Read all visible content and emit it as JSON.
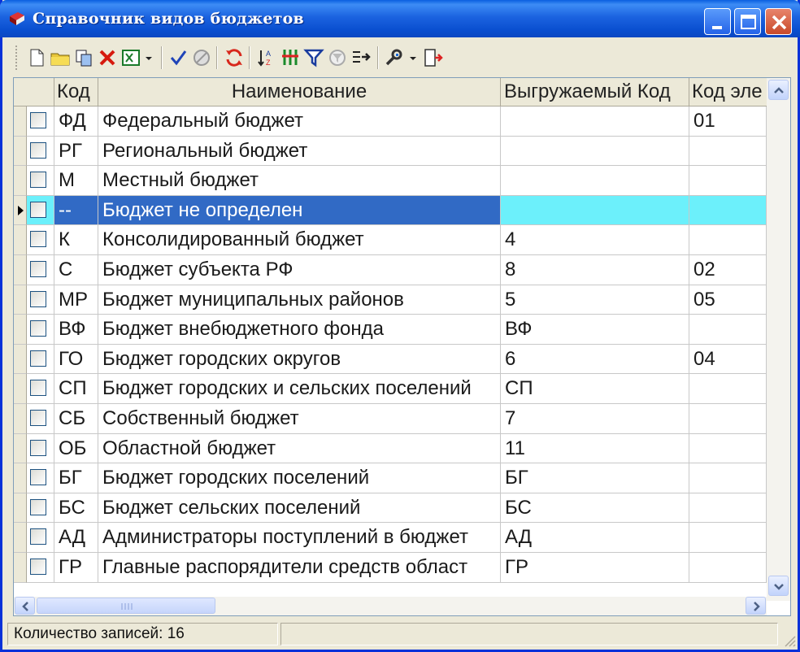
{
  "window": {
    "title": "Справочник видов бюджетов"
  },
  "toolbar": {
    "buttons": [
      {
        "icon": "new-document-icon"
      },
      {
        "icon": "open-folder-icon"
      },
      {
        "icon": "copy-icon"
      },
      {
        "icon": "delete-icon"
      },
      {
        "icon": "excel-export-icon"
      },
      {
        "icon": "dropdown-arrow-icon"
      },
      {
        "icon": "check-icon"
      },
      {
        "icon": "cancel-icon"
      },
      {
        "icon": "refresh-icon"
      },
      {
        "icon": "sort-icon"
      },
      {
        "icon": "column-icon"
      },
      {
        "icon": "filter-icon"
      },
      {
        "icon": "clear-filter-icon"
      },
      {
        "icon": "goto-icon"
      },
      {
        "icon": "settings-icon"
      },
      {
        "icon": "exit-icon"
      }
    ]
  },
  "grid": {
    "columns": [
      "Код",
      "Наименование",
      "Выгружаемый Код",
      "Код эле"
    ],
    "selected_index": 3,
    "rows": [
      {
        "code": "ФД",
        "name": "Федеральный бюджет",
        "export_code": "",
        "element_code": "01"
      },
      {
        "code": "РГ",
        "name": "Региональный бюджет",
        "export_code": "",
        "element_code": ""
      },
      {
        "code": "М",
        "name": "Местный бюджет",
        "export_code": "",
        "element_code": ""
      },
      {
        "code": "--",
        "name": "Бюджет не определен",
        "export_code": "",
        "element_code": ""
      },
      {
        "code": "К",
        "name": "Консолидированный бюджет",
        "export_code": "4",
        "element_code": ""
      },
      {
        "code": "С",
        "name": "Бюджет субъекта РФ",
        "export_code": "8",
        "element_code": "02"
      },
      {
        "code": "МР",
        "name": "Бюджет муниципальных районов",
        "export_code": "5",
        "element_code": "05"
      },
      {
        "code": "ВФ",
        "name": "Бюджет внебюджетного фонда",
        "export_code": "ВФ",
        "element_code": ""
      },
      {
        "code": "ГО",
        "name": "Бюджет городских округов",
        "export_code": "6",
        "element_code": "04"
      },
      {
        "code": "СП",
        "name": "Бюджет городских и сельских поселений",
        "export_code": "СП",
        "element_code": ""
      },
      {
        "code": "СБ",
        "name": "Собственный бюджет",
        "export_code": "7",
        "element_code": ""
      },
      {
        "code": "ОБ",
        "name": "Областной бюджет",
        "export_code": "11",
        "element_code": ""
      },
      {
        "code": "БГ",
        "name": "Бюджет городских поселений",
        "export_code": "БГ",
        "element_code": ""
      },
      {
        "code": "БС",
        "name": "Бюджет сельских поселений",
        "export_code": "БС",
        "element_code": ""
      },
      {
        "code": "АД",
        "name": "Администраторы поступлений в бюджет",
        "export_code": "АД",
        "element_code": ""
      },
      {
        "code": "ГР",
        "name": "Главные распорядители средств област",
        "export_code": "ГР",
        "element_code": ""
      }
    ]
  },
  "status": {
    "record_count": "Количество записей: 16"
  },
  "colors": {
    "selection": "#316ac5",
    "selection_row": "#6cf0fb",
    "titlebar": "#0a4fd0"
  }
}
